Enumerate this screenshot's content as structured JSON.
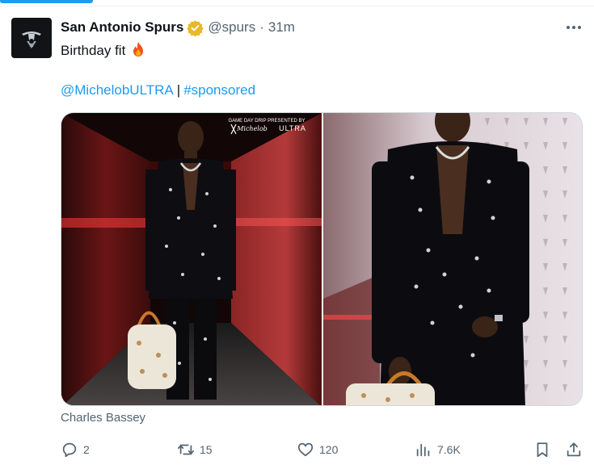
{
  "tweet": {
    "author_name": "San Antonio Spurs",
    "handle": "@spurs",
    "separator": "·",
    "time": "31m",
    "text": "Birthday fit",
    "text_emoji": "fire-emoji",
    "links": {
      "mention": "@MichelobULTRA",
      "separator": "|",
      "hashtag": "#sponsored"
    },
    "media": {
      "overlay_line1": "GAME DAY DRIP PRESENTED BY",
      "overlay_brand_script": "Michelob",
      "overlay_brand_caps": "ULTRA",
      "caption": "Charles Bassey"
    },
    "actions": {
      "replies": "2",
      "reposts": "15",
      "likes": "120",
      "views": "7.6K"
    }
  },
  "icons": {
    "avatar": "spurs-logo",
    "verified": "gold-verified-badge-icon",
    "more": "more-dots-icon",
    "reply": "reply-icon",
    "repost": "repost-icon",
    "like": "heart-icon",
    "views": "views-chart-icon",
    "bookmark": "bookmark-icon",
    "share": "share-icon"
  },
  "colors": {
    "accent": "#1d9bf0",
    "verified_gold": "#e8b828",
    "secondary_text": "#536471"
  }
}
